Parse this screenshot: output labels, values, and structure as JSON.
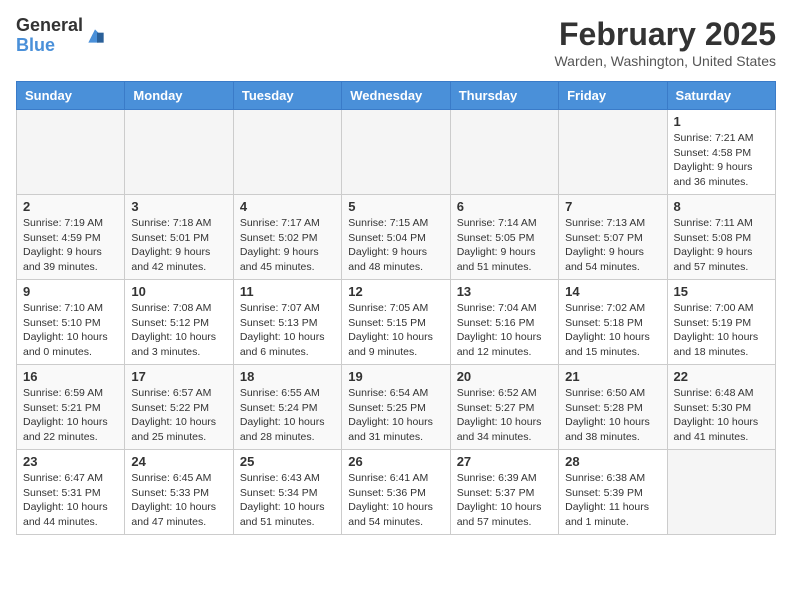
{
  "header": {
    "logo": {
      "general": "General",
      "blue": "Blue"
    },
    "month": "February 2025",
    "location": "Warden, Washington, United States"
  },
  "weekdays": [
    "Sunday",
    "Monday",
    "Tuesday",
    "Wednesday",
    "Thursday",
    "Friday",
    "Saturday"
  ],
  "weeks": [
    [
      {
        "day": "",
        "info": ""
      },
      {
        "day": "",
        "info": ""
      },
      {
        "day": "",
        "info": ""
      },
      {
        "day": "",
        "info": ""
      },
      {
        "day": "",
        "info": ""
      },
      {
        "day": "",
        "info": ""
      },
      {
        "day": "1",
        "info": "Sunrise: 7:21 AM\nSunset: 4:58 PM\nDaylight: 9 hours\nand 36 minutes."
      }
    ],
    [
      {
        "day": "2",
        "info": "Sunrise: 7:19 AM\nSunset: 4:59 PM\nDaylight: 9 hours\nand 39 minutes."
      },
      {
        "day": "3",
        "info": "Sunrise: 7:18 AM\nSunset: 5:01 PM\nDaylight: 9 hours\nand 42 minutes."
      },
      {
        "day": "4",
        "info": "Sunrise: 7:17 AM\nSunset: 5:02 PM\nDaylight: 9 hours\nand 45 minutes."
      },
      {
        "day": "5",
        "info": "Sunrise: 7:15 AM\nSunset: 5:04 PM\nDaylight: 9 hours\nand 48 minutes."
      },
      {
        "day": "6",
        "info": "Sunrise: 7:14 AM\nSunset: 5:05 PM\nDaylight: 9 hours\nand 51 minutes."
      },
      {
        "day": "7",
        "info": "Sunrise: 7:13 AM\nSunset: 5:07 PM\nDaylight: 9 hours\nand 54 minutes."
      },
      {
        "day": "8",
        "info": "Sunrise: 7:11 AM\nSunset: 5:08 PM\nDaylight: 9 hours\nand 57 minutes."
      }
    ],
    [
      {
        "day": "9",
        "info": "Sunrise: 7:10 AM\nSunset: 5:10 PM\nDaylight: 10 hours\nand 0 minutes."
      },
      {
        "day": "10",
        "info": "Sunrise: 7:08 AM\nSunset: 5:12 PM\nDaylight: 10 hours\nand 3 minutes."
      },
      {
        "day": "11",
        "info": "Sunrise: 7:07 AM\nSunset: 5:13 PM\nDaylight: 10 hours\nand 6 minutes."
      },
      {
        "day": "12",
        "info": "Sunrise: 7:05 AM\nSunset: 5:15 PM\nDaylight: 10 hours\nand 9 minutes."
      },
      {
        "day": "13",
        "info": "Sunrise: 7:04 AM\nSunset: 5:16 PM\nDaylight: 10 hours\nand 12 minutes."
      },
      {
        "day": "14",
        "info": "Sunrise: 7:02 AM\nSunset: 5:18 PM\nDaylight: 10 hours\nand 15 minutes."
      },
      {
        "day": "15",
        "info": "Sunrise: 7:00 AM\nSunset: 5:19 PM\nDaylight: 10 hours\nand 18 minutes."
      }
    ],
    [
      {
        "day": "16",
        "info": "Sunrise: 6:59 AM\nSunset: 5:21 PM\nDaylight: 10 hours\nand 22 minutes."
      },
      {
        "day": "17",
        "info": "Sunrise: 6:57 AM\nSunset: 5:22 PM\nDaylight: 10 hours\nand 25 minutes."
      },
      {
        "day": "18",
        "info": "Sunrise: 6:55 AM\nSunset: 5:24 PM\nDaylight: 10 hours\nand 28 minutes."
      },
      {
        "day": "19",
        "info": "Sunrise: 6:54 AM\nSunset: 5:25 PM\nDaylight: 10 hours\nand 31 minutes."
      },
      {
        "day": "20",
        "info": "Sunrise: 6:52 AM\nSunset: 5:27 PM\nDaylight: 10 hours\nand 34 minutes."
      },
      {
        "day": "21",
        "info": "Sunrise: 6:50 AM\nSunset: 5:28 PM\nDaylight: 10 hours\nand 38 minutes."
      },
      {
        "day": "22",
        "info": "Sunrise: 6:48 AM\nSunset: 5:30 PM\nDaylight: 10 hours\nand 41 minutes."
      }
    ],
    [
      {
        "day": "23",
        "info": "Sunrise: 6:47 AM\nSunset: 5:31 PM\nDaylight: 10 hours\nand 44 minutes."
      },
      {
        "day": "24",
        "info": "Sunrise: 6:45 AM\nSunset: 5:33 PM\nDaylight: 10 hours\nand 47 minutes."
      },
      {
        "day": "25",
        "info": "Sunrise: 6:43 AM\nSunset: 5:34 PM\nDaylight: 10 hours\nand 51 minutes."
      },
      {
        "day": "26",
        "info": "Sunrise: 6:41 AM\nSunset: 5:36 PM\nDaylight: 10 hours\nand 54 minutes."
      },
      {
        "day": "27",
        "info": "Sunrise: 6:39 AM\nSunset: 5:37 PM\nDaylight: 10 hours\nand 57 minutes."
      },
      {
        "day": "28",
        "info": "Sunrise: 6:38 AM\nSunset: 5:39 PM\nDaylight: 11 hours\nand 1 minute."
      },
      {
        "day": "",
        "info": ""
      }
    ]
  ]
}
